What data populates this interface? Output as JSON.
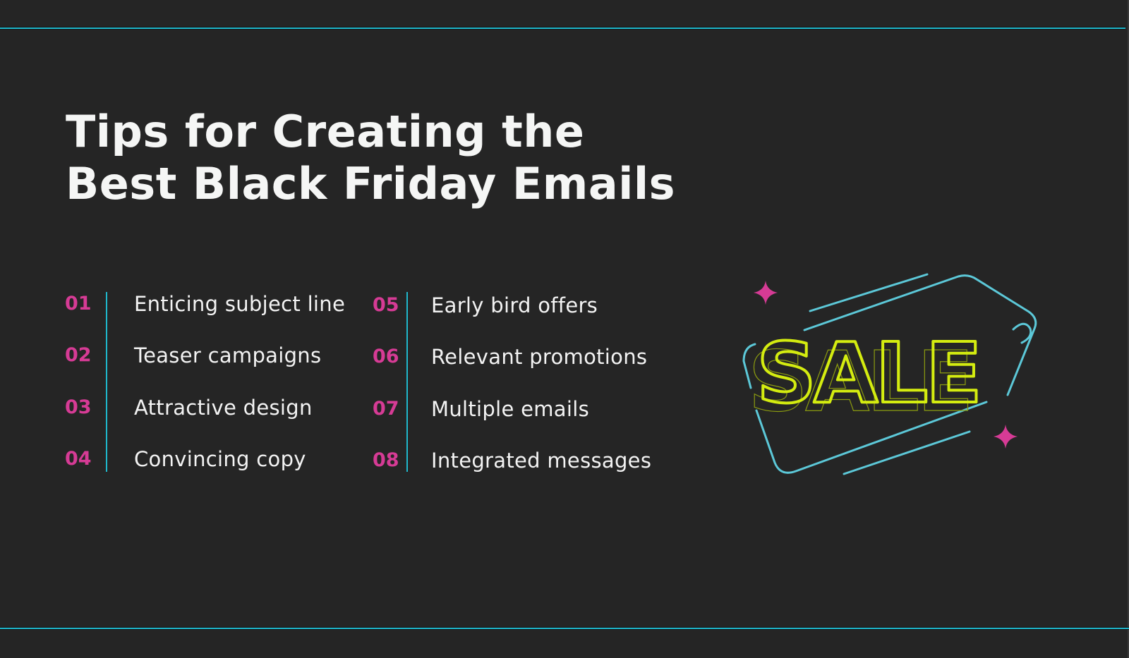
{
  "title": {
    "line1": "Tips for Creating the",
    "line2": "Best Black Friday Emails"
  },
  "tips": [
    {
      "number": "01",
      "label": "Enticing subject line"
    },
    {
      "number": "02",
      "label": "Teaser campaigns"
    },
    {
      "number": "03",
      "label": "Attractive design"
    },
    {
      "number": "04",
      "label": "Convincing copy"
    },
    {
      "number": "05",
      "label": "Early bird offers"
    },
    {
      "number": "06",
      "label": "Relevant promotions"
    },
    {
      "number": "07",
      "label": "Multiple emails"
    },
    {
      "number": "08",
      "label": "Integrated messages"
    }
  ],
  "illustration": {
    "text": "SALE",
    "icon": "sale-tag-icon",
    "sparkle_icon": "sparkle-icon"
  },
  "colors": {
    "background": "#252525",
    "accent_cyan": "#1fb8cc",
    "tag_cyan": "#5cc8d8",
    "number_pink": "#d63b95",
    "neon_yellow": "#d4ec10",
    "text_white": "#f3f3f3"
  }
}
